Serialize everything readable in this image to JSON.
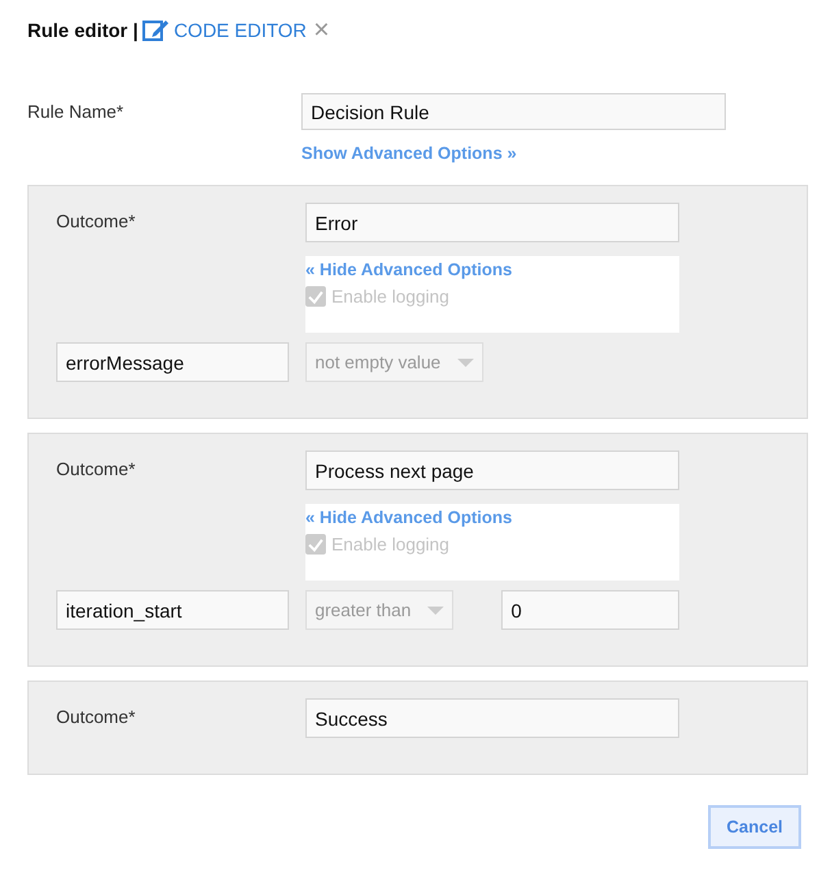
{
  "header": {
    "title": "Rule editor |",
    "code_editor_link": "CODE EDITOR",
    "close": "×"
  },
  "rule_name": {
    "label": "Rule Name*",
    "value": "Decision Rule",
    "advanced_link": "Show Advanced Options »"
  },
  "outcomes": [
    {
      "label": "Outcome*",
      "value": "Error",
      "advanced": {
        "link": "« Hide Advanced Options",
        "logging_label": "Enable logging",
        "checked": true,
        "disabled": true
      },
      "condition": {
        "field": "errorMessage",
        "operator": "not empty value",
        "operator_disabled": true
      }
    },
    {
      "label": "Outcome*",
      "value": "Process next page",
      "advanced": {
        "link": "« Hide Advanced Options",
        "logging_label": "Enable logging",
        "checked": true,
        "disabled": true
      },
      "condition": {
        "field": "iteration_start",
        "operator": "greater than",
        "operator_disabled": true,
        "value": "0"
      }
    },
    {
      "label": "Outcome*",
      "value": "Success"
    }
  ],
  "buttons": [
    {
      "label": "Cancel"
    }
  ]
}
